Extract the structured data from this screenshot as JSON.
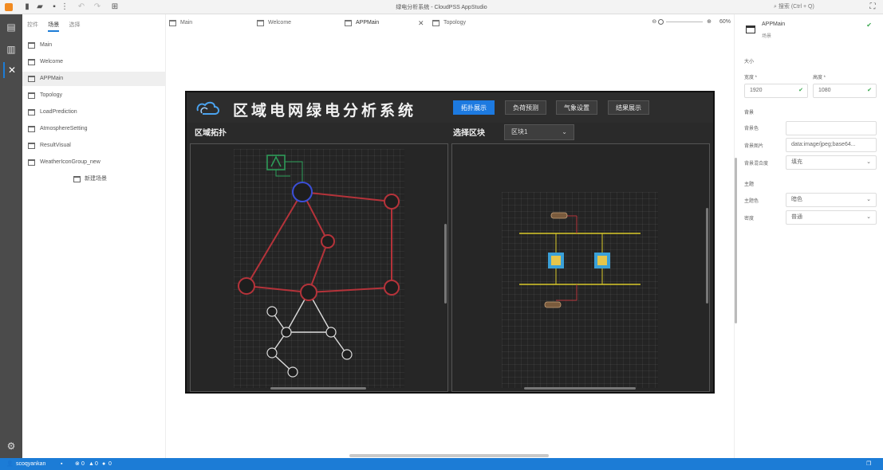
{
  "window": {
    "title": "绿电分析系统 - CloudPSS AppStudio",
    "search_placeholder": "搜索 (Ctrl + Q)"
  },
  "sidebar": {
    "tabs": [
      {
        "label": "控件"
      },
      {
        "label": "场景",
        "active": true
      },
      {
        "label": "选择"
      }
    ],
    "items": [
      {
        "label": "Main"
      },
      {
        "label": "Welcome"
      },
      {
        "label": "APPMain",
        "selected": true
      },
      {
        "label": "Topology"
      },
      {
        "label": "LoadPrediction"
      },
      {
        "label": "AtmosphereSetting"
      },
      {
        "label": "ResultVisual"
      },
      {
        "label": "WeatherIconGroup_new"
      }
    ],
    "child_item": {
      "label": "新建场景"
    }
  },
  "tabs": [
    {
      "label": "Main"
    },
    {
      "label": "Welcome"
    },
    {
      "label": "APPMain",
      "active": true
    },
    {
      "label": "Topology"
    }
  ],
  "zoom": {
    "value": "60%"
  },
  "canvas": {
    "title": "区域电网绿电分析系统",
    "nav": [
      {
        "label": "拓扑展示",
        "active": true
      },
      {
        "label": "负荷预测"
      },
      {
        "label": "气象设置"
      },
      {
        "label": "结果展示"
      }
    ],
    "left_section_title": "区域拓扑",
    "right_section_title": "选择区块",
    "region_select_value": "区块1"
  },
  "properties": {
    "name": "APPMain",
    "type": "场景",
    "size_section": "大小",
    "width_label": "宽度 *",
    "width_value": "1920",
    "height_label": "高度 *",
    "height_value": "1080",
    "bg_section": "背景",
    "bg_color_label": "背景色",
    "bg_color_value": "",
    "bg_image_label": "背景图片",
    "bg_image_value": "data:image/jpeg;base64...",
    "bg_mode_label": "背景混合度",
    "bg_mode_value": "填充",
    "theme_section": "主题",
    "theme_color_label": "主题色",
    "theme_color_value": "暗色",
    "density_label": "密度",
    "density_value": "普通"
  },
  "status": {
    "user": "scoqyankan",
    "counts": "0  0  0",
    "errors": "0",
    "warnings": "0",
    "infos": "0"
  },
  "colors": {
    "accent": "#1c7cd6",
    "line_red": "#b5333a",
    "line_white": "#dddddd",
    "bus_yellow": "#d8c82a",
    "gen_green": "#2da05a"
  }
}
